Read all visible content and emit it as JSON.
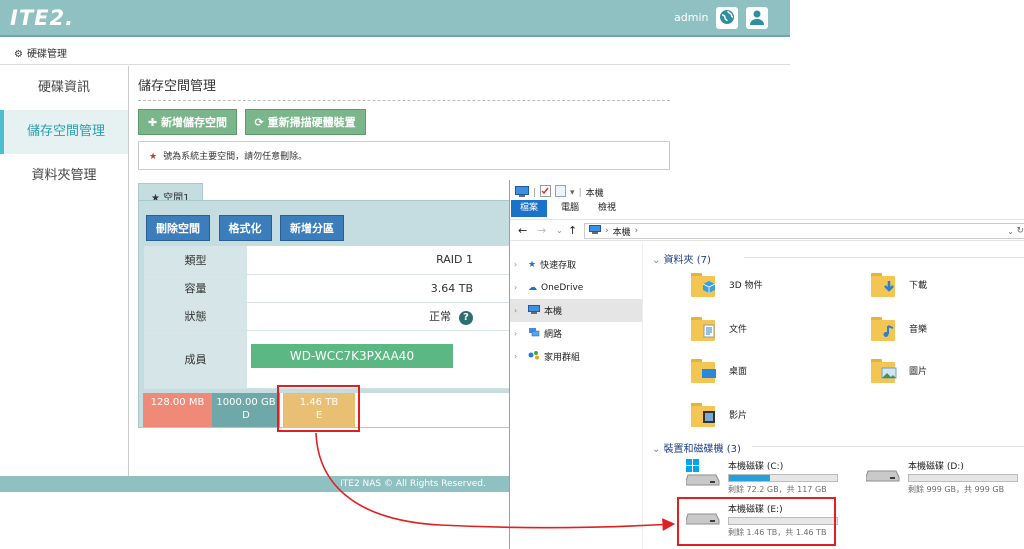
{
  "app": {
    "logo": "ITE2.",
    "user": "admin",
    "breadcrumb": "硬碟管理",
    "footer": "ITE2 NAS © All Rights Reserved."
  },
  "sidebar": {
    "items": [
      {
        "label": "硬碟資訊"
      },
      {
        "label": "儲存空間管理"
      },
      {
        "label": "資料夾管理"
      }
    ]
  },
  "main": {
    "title": "儲存空間管理",
    "add_storage": "新增儲存空間",
    "rescan": "重新掃描硬體裝置",
    "notice": "號為系統主要空間，請勿任意刪除。",
    "tab": "空間1",
    "actions": {
      "delete": "刪除空間",
      "format": "格式化",
      "add_partition": "新增分區"
    },
    "props": {
      "type_k": "類型",
      "type_v": "RAID 1",
      "capacity_k": "容量",
      "capacity_v": "3.64 TB",
      "status_k": "狀態",
      "status_v": "正常",
      "members_k": "成員",
      "member1": "WD-WCC7K3PXAA40"
    },
    "partitions": [
      {
        "size": "128.00 MB",
        "label": "",
        "color": "#f08a78"
      },
      {
        "size": "1000.00 GB",
        "label": "D",
        "color": "#6fa8a9"
      },
      {
        "size": "1.46 TB",
        "label": "E",
        "color": "#e9c073"
      }
    ]
  },
  "explorer": {
    "title": "本機",
    "tabs": [
      "檔案",
      "電腦",
      "檢視"
    ],
    "address": "本機",
    "nav": [
      "快速存取",
      "OneDrive",
      "本機",
      "網路",
      "家用群組"
    ],
    "folders_header": "資料夾 (7)",
    "folders": [
      "3D 物件",
      "下載",
      "文件",
      "音樂",
      "桌面",
      "圖片",
      "影片"
    ],
    "drives_header": "裝置和磁碟機 (3)",
    "drives": [
      {
        "name": "本機磁碟 (C:)",
        "free": "剩餘 72.2 GB，共 117 GB",
        "used_fraction": 0.38
      },
      {
        "name": "本機磁碟 (D:)",
        "free": "剩餘 999 GB，共 999 GB",
        "used_fraction": 0.0
      },
      {
        "name": "本機磁碟 (E:)",
        "free": "剩餘 1.46 TB，共 1.46 TB",
        "used_fraction": 0.0
      }
    ]
  }
}
